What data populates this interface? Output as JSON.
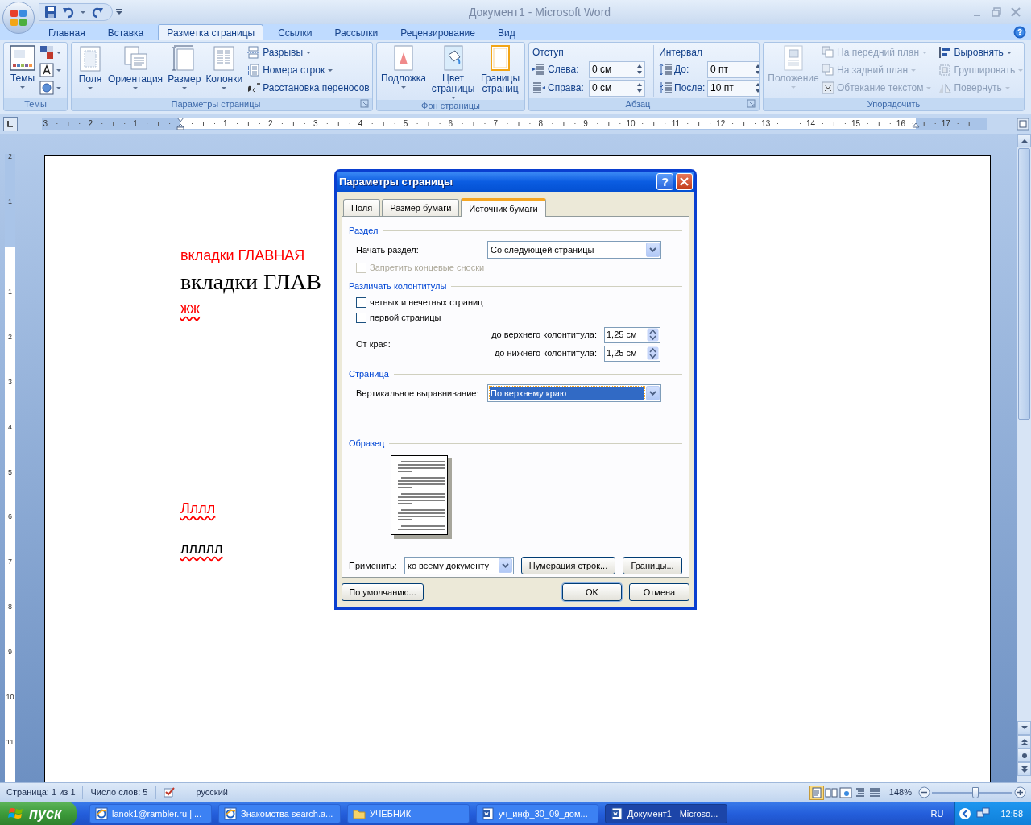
{
  "window": {
    "title": "Документ1 - Microsoft Word"
  },
  "ribbon_tabs": [
    {
      "label": "Главная",
      "selected": false
    },
    {
      "label": "Вставка",
      "selected": false
    },
    {
      "label": "Разметка страницы",
      "selected": true
    },
    {
      "label": "Ссылки",
      "selected": false
    },
    {
      "label": "Рассылки",
      "selected": false
    },
    {
      "label": "Рецензирование",
      "selected": false
    },
    {
      "label": "Вид",
      "selected": false
    }
  ],
  "ribbon": {
    "themes": {
      "label": "Темы",
      "button": "Темы"
    },
    "page_setup": {
      "label": "Параметры страницы",
      "large_buttons": [
        "Поля",
        "Ориентация",
        "Размер",
        "Колонки"
      ],
      "small_buttons": [
        "Разрывы",
        "Номера строк",
        "Расстановка переносов"
      ]
    },
    "page_background": {
      "label": "Фон страницы",
      "buttons": [
        "Подложка",
        "Цвет страницы",
        "Границы страниц"
      ]
    },
    "paragraph": {
      "label": "Абзац",
      "indent": {
        "heading": "Отступ",
        "fields": [
          {
            "label": "Слева:",
            "value": "0 см"
          },
          {
            "label": "Справа:",
            "value": "0 см"
          }
        ]
      },
      "spacing": {
        "heading": "Интервал",
        "fields": [
          {
            "label": "До:",
            "value": "0 пт"
          },
          {
            "label": "После:",
            "value": "10 пт"
          }
        ]
      }
    },
    "arrange": {
      "label": "Упорядочить",
      "position": {
        "label": "Положение",
        "disabled": true
      },
      "commands": [
        {
          "label": "На передний план",
          "disabled": true
        },
        {
          "label": "На задний план",
          "disabled": true
        },
        {
          "label": "Обтекание текстом",
          "disabled": true
        },
        {
          "label": "Выровнять",
          "disabled": false
        },
        {
          "label": "Группировать",
          "disabled": true
        },
        {
          "label": "Повернуть",
          "disabled": true
        }
      ]
    }
  },
  "ruler": {
    "horizontal": [
      "3",
      "2",
      "1",
      "1",
      "2",
      "3",
      "4",
      "5",
      "6",
      "7",
      "8",
      "9",
      "10",
      "11",
      "12",
      "13",
      "14",
      "15",
      "16",
      "17"
    ],
    "vertical": [
      "2",
      "1",
      "1",
      "2",
      "3",
      "4",
      "5",
      "6",
      "7",
      "8",
      "9",
      "10",
      "11"
    ]
  },
  "document": {
    "paragraphs": [
      {
        "text": "вкладки ГЛАВНАЯ",
        "kind": "sans",
        "color": "#ff0000",
        "misspelled": false
      },
      {
        "text": "вкладки ГЛАВ",
        "kind": "serif",
        "color": "#000000",
        "misspelled": false
      },
      {
        "text": "жж",
        "kind": "sans",
        "color": "#ff0000",
        "misspelled": true
      },
      {
        "text": "Лллл",
        "kind": "sans",
        "color": "#ff0000",
        "misspelled": true
      },
      {
        "text": "ллллл",
        "kind": "sans",
        "color": "#000000",
        "misspelled": true
      }
    ]
  },
  "dialog": {
    "title": "Параметры страницы",
    "help": "?",
    "tabs": [
      {
        "label": "Поля",
        "selected": false
      },
      {
        "label": "Размер бумаги",
        "selected": false
      },
      {
        "label": "Источник бумаги",
        "selected": true
      }
    ],
    "section_heading": "Раздел",
    "start_label": "Начать раздел:",
    "start_value": "Со следующей страницы",
    "suppress": {
      "label": "Запретить концевые сноски",
      "checked": false,
      "disabled": true
    },
    "headers_heading": "Различать колонтитулы",
    "header_options": [
      {
        "label": "четных и нечетных страниц",
        "checked": false,
        "disabled": false
      },
      {
        "label": "первой страницы",
        "checked": false,
        "disabled": false
      }
    ],
    "from_edge": "От края:",
    "edge_fields": [
      {
        "label": "до верхнего колонтитула:",
        "value": "1,25 см"
      },
      {
        "label": "до нижнего колонтитула:",
        "value": "1,25 см"
      }
    ],
    "page_heading": "Страница",
    "valign": {
      "label": "Вертикальное выравнивание:",
      "value": "По верхнему краю",
      "focused": true
    },
    "preview_heading": "Образец",
    "apply_label": "Применить:",
    "apply_value": "ко всему документу",
    "buttons": [
      "Нумерация строк...",
      "Границы..."
    ],
    "default_button": "По умолчанию...",
    "ok": "OK",
    "cancel": "Отмена"
  },
  "status_bar": {
    "page": "Страница: 1 из 1",
    "words": "Число слов: 5",
    "language": "русский",
    "views": [
      {
        "selected": true
      },
      {
        "selected": false
      },
      {
        "selected": false
      },
      {
        "selected": false
      },
      {
        "selected": false
      }
    ],
    "zoom": "148%",
    "zoom_slider": {
      "level": 0.54
    }
  },
  "taskbar": {
    "start": "пуск",
    "tasks": [
      {
        "label": "lanok1@rambler.ru | ...",
        "kind": "browser",
        "selected": false
      },
      {
        "label": "Знакомства search.a...",
        "kind": "browser",
        "selected": false
      },
      {
        "label": "УЧЕБНИК",
        "kind": "folder",
        "selected": false
      },
      {
        "label": "уч_инф_30_09_дом...",
        "kind": "document",
        "selected": false
      },
      {
        "label": "Документ1 - Microso...",
        "kind": "document",
        "selected": true
      }
    ],
    "language": "RU",
    "clock": "12:58"
  }
}
